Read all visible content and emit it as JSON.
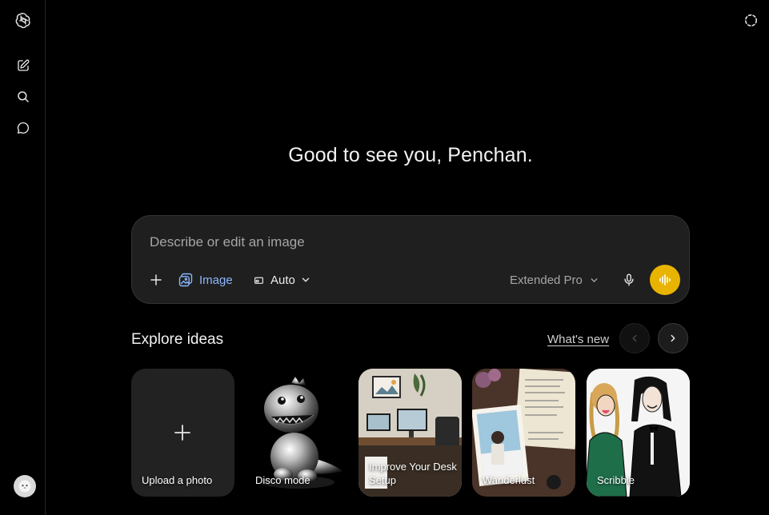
{
  "greeting": "Good to see you, Penchan.",
  "composer": {
    "placeholder": "Describe or edit an image",
    "image_label": "Image",
    "aspect_label": "Auto",
    "model_label": "Extended Pro"
  },
  "explore": {
    "title": "Explore ideas",
    "whats_new": "What's new",
    "cards": [
      {
        "label": "Upload a photo"
      },
      {
        "label": "Disco mode"
      },
      {
        "label": "Improve Your Desk Setup"
      },
      {
        "label": "Wanderlust"
      },
      {
        "label": "Scribble"
      }
    ]
  },
  "colors": {
    "accent_blue": "#8ab8ff",
    "voice_button": "#e8b400",
    "composer_bg": "#1f1f1f"
  },
  "icons": {
    "logo": "openai-logo-icon",
    "new_chat": "edit-icon",
    "search": "search-icon",
    "chats": "chat-bubble-icon",
    "top_right": "temporary-chat-icon"
  }
}
